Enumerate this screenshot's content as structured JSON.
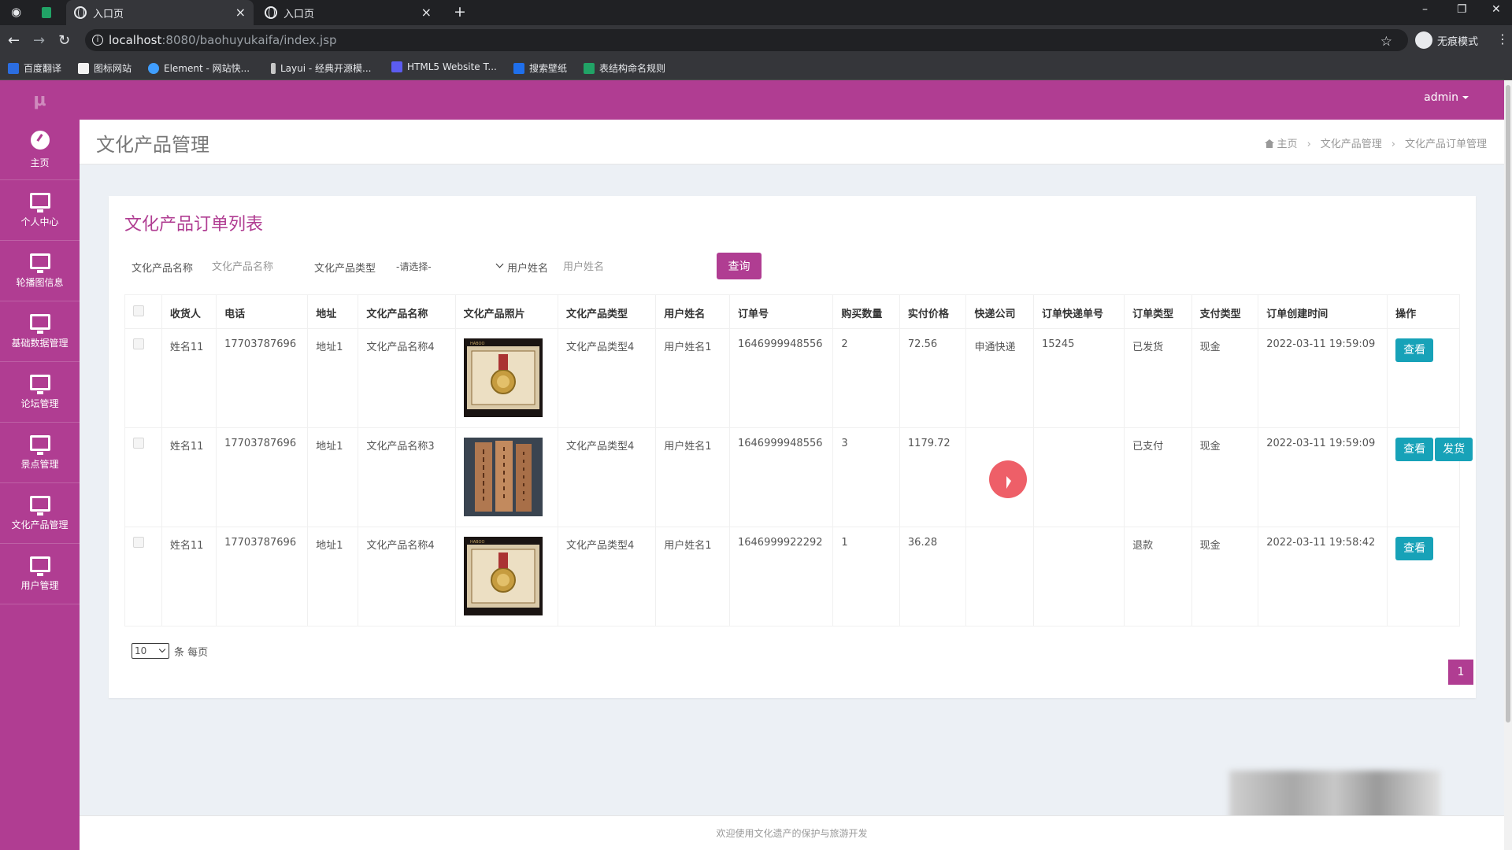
{
  "browser": {
    "tabs": [
      {
        "label": "入口页",
        "active": true
      },
      {
        "label": "入口页",
        "active": false
      }
    ],
    "url_host": "localhost",
    "url_path": ":8080/baohuyukaifa/index.jsp",
    "incognito_label": "无痕模式",
    "bookmarks": [
      {
        "label": "百度翻译",
        "color": "#2b6de0"
      },
      {
        "label": "图标网站",
        "color": "#f2f2f2"
      },
      {
        "label": "Element - 网站快...",
        "color": "#409eff"
      },
      {
        "label": "Layui - 经典开源模...",
        "color": "#c7c7c7"
      },
      {
        "label": "HTML5 Website T...",
        "color": "#5c5cf0"
      },
      {
        "label": "搜索壁纸",
        "color": "#1f6feb"
      },
      {
        "label": "表结构命名规则",
        "color": "#21a366"
      }
    ]
  },
  "header": {
    "user": "admin"
  },
  "sidebar": {
    "logo": "μ",
    "items": [
      {
        "label": "主页",
        "icon": "dashboard-icon"
      },
      {
        "label": "个人中心",
        "icon": "monitor-icon"
      },
      {
        "label": "轮播图信息",
        "icon": "monitor-icon"
      },
      {
        "label": "基础数据管理",
        "icon": "monitor-icon"
      },
      {
        "label": "论坛管理",
        "icon": "monitor-icon"
      },
      {
        "label": "景点管理",
        "icon": "monitor-icon"
      },
      {
        "label": "文化产品管理",
        "icon": "monitor-icon"
      },
      {
        "label": "用户管理",
        "icon": "monitor-icon"
      }
    ]
  },
  "page": {
    "title": "文化产品管理",
    "breadcrumb": [
      "主页",
      "文化产品管理",
      "文化产品订单管理"
    ],
    "card_title": "文化产品订单列表"
  },
  "filters": {
    "name_label": "文化产品名称",
    "name_placeholder": "文化产品名称",
    "type_label": "文化产品类型",
    "type_value": "-请选择-",
    "user_label": "用户姓名",
    "user_placeholder": "用户姓名",
    "query_button": "查询"
  },
  "table": {
    "headers": [
      "收货人",
      "电话",
      "地址",
      "文化产品名称",
      "文化产品照片",
      "文化产品类型",
      "用户姓名",
      "订单号",
      "购买数量",
      "实付价格",
      "快递公司",
      "订单快递单号",
      "订单类型",
      "支付类型",
      "订单创建时间",
      "操作"
    ],
    "rows": [
      {
        "receiver": "姓名11",
        "phone": "17703787696",
        "address": "地址1",
        "product": "文化产品名称4",
        "photo": "medal",
        "type": "文化产品类型4",
        "user": "用户姓名1",
        "order_no": "1646999948556",
        "qty": "2",
        "price": "72.56",
        "courier": "申通快递",
        "tracking": "15245",
        "status": "已发货",
        "pay": "现金",
        "created": "2022-03-11 19:59:09",
        "actions": [
          "查看"
        ]
      },
      {
        "receiver": "姓名11",
        "phone": "17703787696",
        "address": "地址1",
        "product": "文化产品名称3",
        "photo": "wood",
        "type": "文化产品类型4",
        "user": "用户姓名1",
        "order_no": "1646999948556",
        "qty": "3",
        "price": "1179.72",
        "courier": "",
        "tracking": "",
        "status": "已支付",
        "pay": "现金",
        "created": "2022-03-11 19:59:09",
        "actions": [
          "查看",
          "发货"
        ]
      },
      {
        "receiver": "姓名11",
        "phone": "17703787696",
        "address": "地址1",
        "product": "文化产品名称4",
        "photo": "medal",
        "type": "文化产品类型4",
        "user": "用户姓名1",
        "order_no": "1646999922292",
        "qty": "1",
        "price": "36.28",
        "courier": "",
        "tracking": "",
        "status": "退款",
        "pay": "现金",
        "created": "2022-03-11 19:58:42",
        "actions": [
          "查看"
        ]
      }
    ]
  },
  "pagination": {
    "page_size": "10",
    "per_page_label": "条 每页",
    "current_page": "1"
  },
  "footer": {
    "text": "欢迎使用文化遗产的保护与旅游开发"
  },
  "colors": {
    "brand": "#b03d92",
    "action": "#17a2b8"
  }
}
